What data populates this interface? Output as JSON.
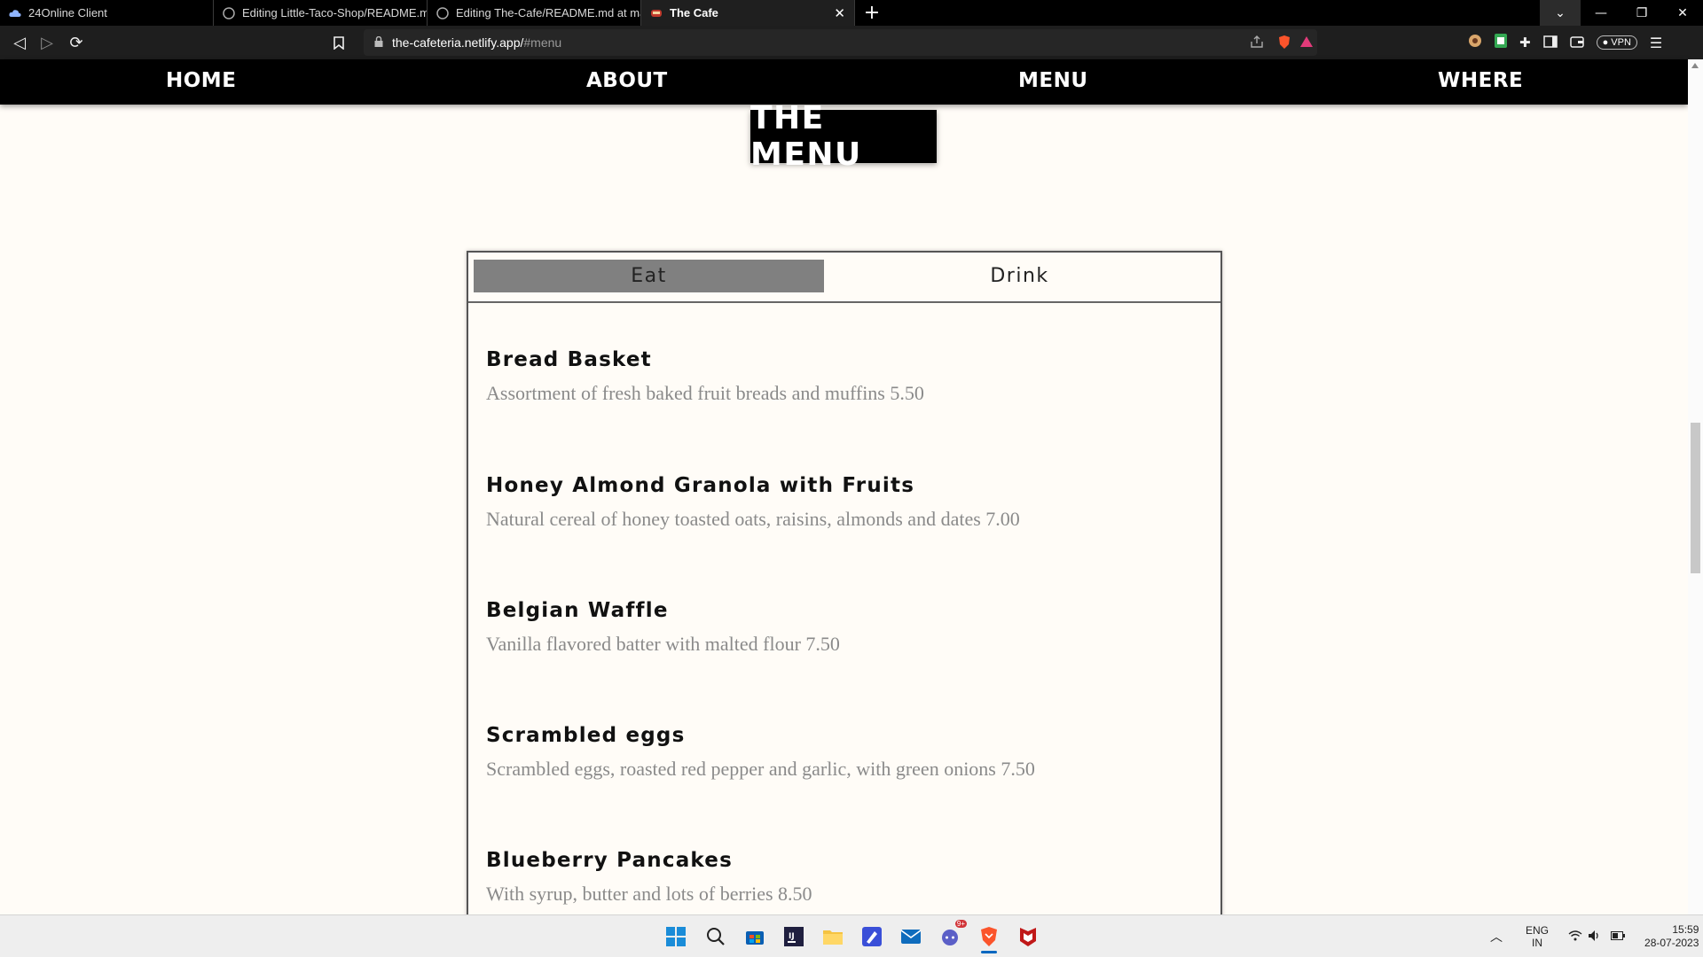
{
  "browser": {
    "tabs": [
      {
        "title": "24Online Client",
        "icon": "cloud-icon"
      },
      {
        "title": "Editing Little-Taco-Shop/README.md",
        "icon": "github-icon"
      },
      {
        "title": "Editing The-Cafe/README.md at main",
        "icon": "github-icon"
      },
      {
        "title": "The Cafe",
        "icon": "cafe-icon",
        "active": true
      }
    ],
    "new_tab": "+",
    "url_host": "the-cafeteria.netlify.app/",
    "url_path": "#menu",
    "vpn_label": "VPN"
  },
  "site_nav": {
    "items": [
      "HOME",
      "ABOUT",
      "MENU",
      "WHERE"
    ]
  },
  "menu": {
    "title": "THE MENU",
    "tabs": [
      {
        "label": "Eat",
        "selected": true
      },
      {
        "label": "Drink",
        "selected": false
      }
    ],
    "items": [
      {
        "name": "Bread Basket",
        "description": "Assortment of fresh baked fruit breads and muffins 5.50"
      },
      {
        "name": "Honey Almond Granola with Fruits",
        "description": "Natural cereal of honey toasted oats, raisins, almonds and dates 7.00"
      },
      {
        "name": "Belgian Waffle",
        "description": "Vanilla flavored batter with malted flour 7.50"
      },
      {
        "name": "Scrambled eggs",
        "description": "Scrambled eggs, roasted red pepper and garlic, with green onions 7.50"
      },
      {
        "name": "Blueberry Pancakes",
        "description": "With syrup, butter and lots of berries 8.50"
      }
    ]
  },
  "taskbar": {
    "lang_top": "ENG",
    "lang_bottom": "IN",
    "time": "15:59",
    "date": "28-07-2023",
    "chat_badge": "9+"
  },
  "colors": {
    "page_bg": "#fffcf7",
    "nav_bg": "#000000",
    "selected_tab": "#808080",
    "description_text": "#8a8a8a"
  }
}
